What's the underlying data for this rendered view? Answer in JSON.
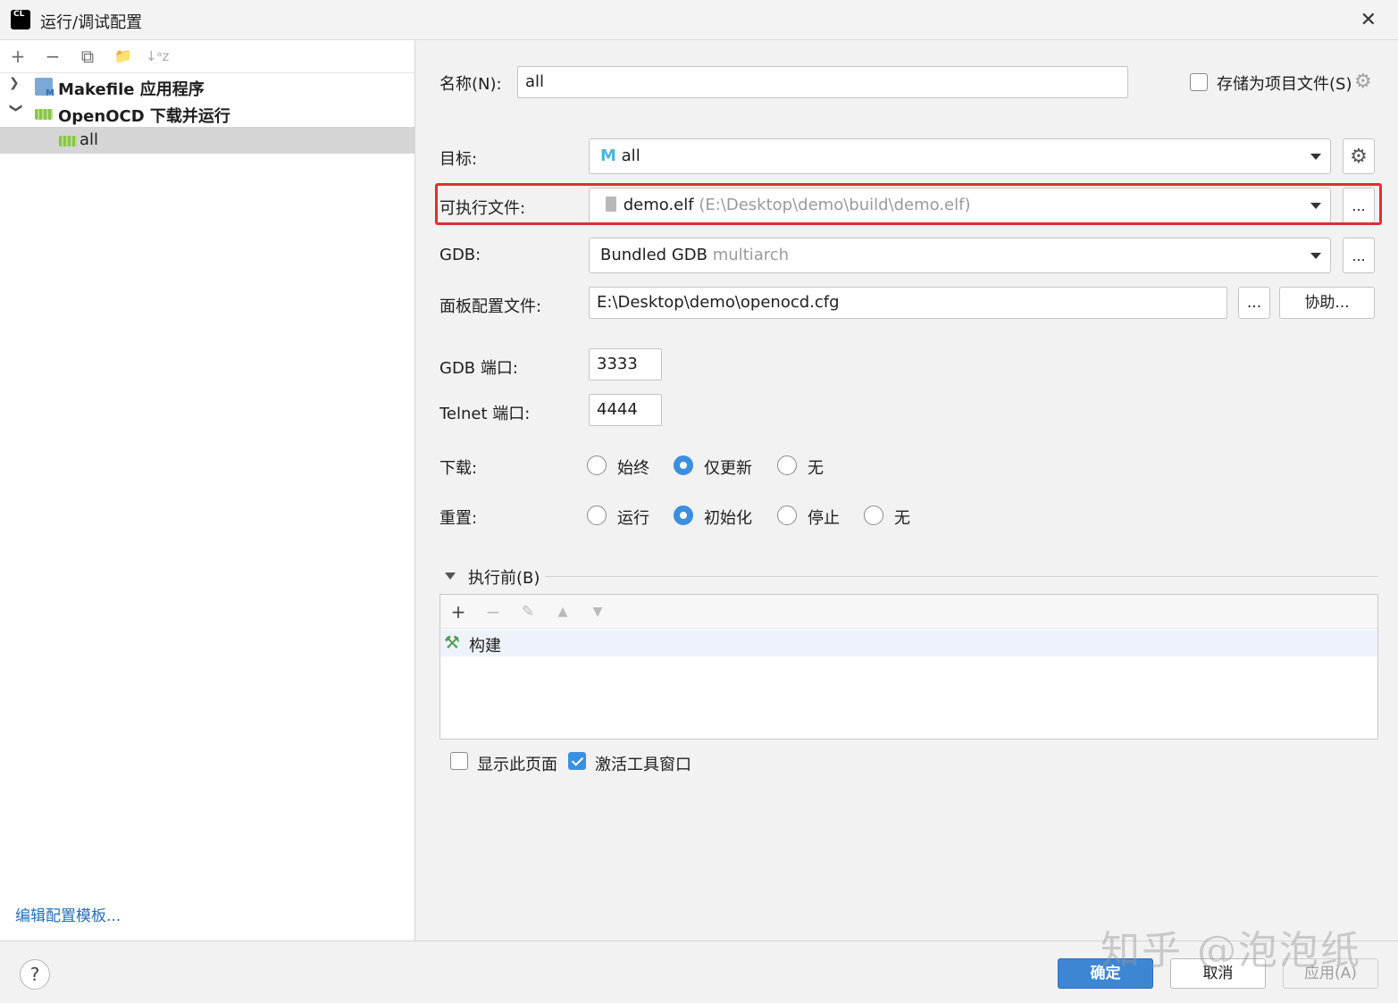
{
  "window": {
    "app_icon_text": "CL",
    "title": "运行/调试配置",
    "close_symbol": "✕"
  },
  "left": {
    "toolbar": [
      "+",
      "−",
      "⧉",
      "📁",
      "↓ᵃz"
    ],
    "tree": [
      {
        "label": "Makefile 应用程序",
        "expanded": false,
        "icon": "makefile-icon"
      },
      {
        "label": "OpenOCD 下载并运行",
        "expanded": true,
        "icon": "openocd-icon"
      },
      {
        "label": "all",
        "selected": true,
        "icon": "chip-icon"
      }
    ],
    "edit_templates": "编辑配置模板..."
  },
  "form": {
    "name_label": "名称(N):",
    "name_value": "all",
    "store_label": "存储为项目文件(S)",
    "store_checked": false,
    "target_label": "目标:",
    "target_value": "all",
    "executable_label": "可执行文件:",
    "executable_name": "demo.elf",
    "executable_path": "(E:\\Desktop\\demo\\build\\demo.elf)",
    "gdb_label": "GDB:",
    "gdb_value": "Bundled GDB",
    "gdb_suffix": "multiarch",
    "board_label": "面板配置文件:",
    "board_value": "E:\\Desktop\\demo\\openocd.cfg",
    "ellipsis": "...",
    "assist_label": "协助...",
    "gdb_port_label": "GDB 端口:",
    "gdb_port_value": "3333",
    "telnet_port_label": "Telnet 端口:",
    "telnet_port_value": "4444",
    "download_label": "下载:",
    "download_options": [
      "始终",
      "仅更新",
      "无"
    ],
    "download_selected": "仅更新",
    "reset_label": "重置:",
    "reset_options": [
      "运行",
      "初始化",
      "停止",
      "无"
    ],
    "reset_selected": "初始化"
  },
  "before_launch": {
    "title": "执行前(B)",
    "items": [
      "构建"
    ],
    "show_page_label": "显示此页面",
    "show_page_checked": false,
    "activate_label": "激活工具窗口",
    "activate_checked": true
  },
  "footer": {
    "help": "?",
    "ok": "确定",
    "cancel": "取消",
    "apply": "应用(A)"
  },
  "watermark": "知乎 @泡泡纸",
  "colors": {
    "accent": "#3d86d3",
    "highlight": "#e0302e",
    "link": "#2470b3"
  }
}
